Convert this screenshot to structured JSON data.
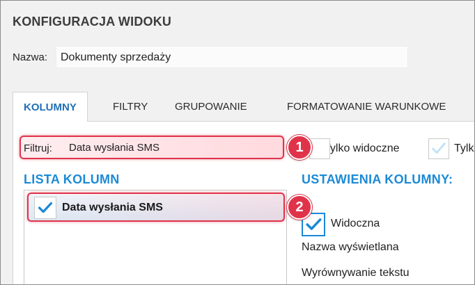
{
  "dialog": {
    "title": "KONFIGURACJA WIDOKU"
  },
  "name_field": {
    "label": "Nazwa:",
    "value": "Dokumenty sprzedaży"
  },
  "tabs": [
    {
      "label": "KOLUMNY",
      "active": true
    },
    {
      "label": "FILTRY",
      "active": false
    },
    {
      "label": "GRUPOWANIE",
      "active": false
    },
    {
      "label": "FORMATOWANIE WARUNKOWE",
      "active": false
    }
  ],
  "filter": {
    "label": "Filtruj:",
    "value": "Data wysłania SMS",
    "only_visible_label": "Tylko widoczne",
    "second_option_label": "Tylk"
  },
  "column_list": {
    "title": "LISTA KOLUMN",
    "items": [
      {
        "label": "Data wysłania SMS",
        "checked": true
      }
    ]
  },
  "column_settings": {
    "title": "USTAWIENIA KOLUMNY:",
    "visible_label": "Widoczna",
    "visible_checked": true,
    "display_name_label": "Nazwa wyświetlana",
    "text_align_label": "Wyrównywanie tekstu"
  },
  "callouts": [
    {
      "number": "1"
    },
    {
      "number": "2"
    }
  ],
  "colors": {
    "accent_blue": "#1c8ad6",
    "callout_red": "#e0334a",
    "check_blue": "#1a88d8"
  }
}
